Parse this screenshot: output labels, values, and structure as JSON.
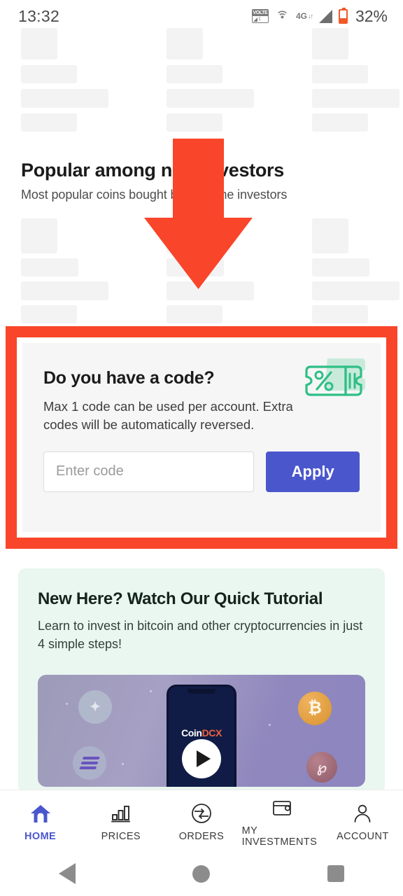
{
  "status_bar": {
    "time": "13:32",
    "volte_label": "VOLTE",
    "volte_sim": "1",
    "network_type": "4G",
    "network_arrows": "↓↑",
    "battery_percent": "32%",
    "icons": [
      "volte-icon",
      "hotspot-icon",
      "4g-icon",
      "signal-icon",
      "battery-icon"
    ]
  },
  "section": {
    "title": "Popular among new investors",
    "subtitle": "Most popular coins bought by first time investors"
  },
  "annotation": {
    "arrow_color": "#f9452a",
    "box_color": "#f9452a"
  },
  "promo": {
    "title": "Do you have a code?",
    "description": "Max 1 code can be used per account. Extra codes will be automatically reversed.",
    "input_placeholder": "Enter code",
    "input_value": "",
    "apply_label": "Apply",
    "apply_color": "#4a57cc",
    "coupon_icon": "coupon-percent-icon",
    "coupon_color": "#2fbf86"
  },
  "tutorial": {
    "title": "New Here? Watch Our Quick Tutorial",
    "subtitle": "Learn to invest in bitcoin and other cryptocurrencies in just 4 simple steps!",
    "card_color": "#eaf6f0",
    "video": {
      "brand_first": "Coin",
      "brand_second": "DCX",
      "play_icon": "play-icon",
      "coins": [
        "cardano-coin",
        "solana-coin",
        "bitcoin-coin",
        "polkadot-coin"
      ],
      "bitcoin_glyph": "₿",
      "cardano_glyph": "✦",
      "polkadot_glyph": "℘"
    }
  },
  "bottom_nav": {
    "items": [
      {
        "label": "HOME",
        "icon": "home-icon",
        "active": true
      },
      {
        "label": "PRICES",
        "icon": "bar-chart-icon",
        "active": false
      },
      {
        "label": "ORDERS",
        "icon": "exchange-arrows-icon",
        "active": false
      },
      {
        "label": "MY INVESTMENTS",
        "icon": "wallet-icon",
        "active": false
      },
      {
        "label": "ACCOUNT",
        "icon": "person-icon",
        "active": false
      }
    ],
    "active_color": "#4a57cc"
  },
  "system_bar": {
    "back": "back-triangle-icon",
    "home": "home-circle-icon",
    "recents": "recents-square-icon"
  }
}
